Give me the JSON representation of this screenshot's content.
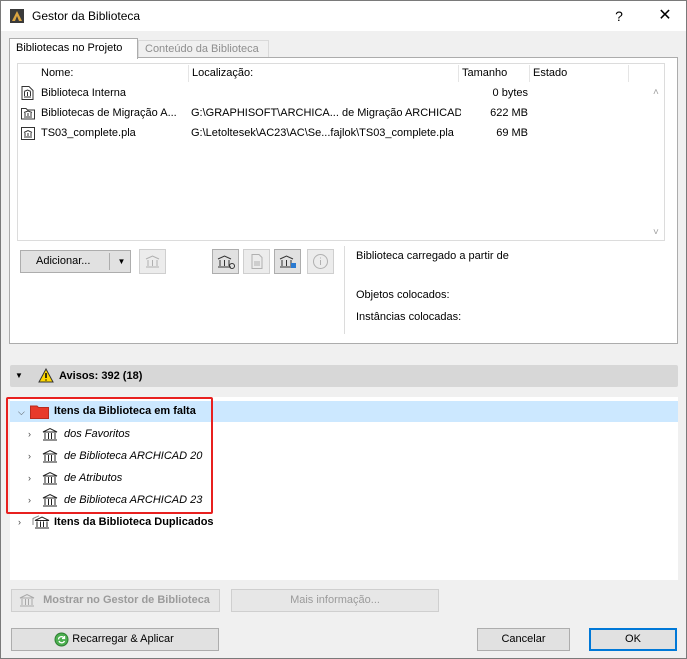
{
  "window": {
    "title": "Gestor da Biblioteca",
    "help_glyph": "?",
    "close_glyph": "✕"
  },
  "tabs": [
    {
      "label": "Bibliotecas no Projeto",
      "active": true
    },
    {
      "label": "Conteúdo da Biblioteca",
      "active": false
    }
  ],
  "table": {
    "columns": [
      "Nome:",
      "Localização:",
      "Tamanho",
      "Estado"
    ],
    "rows": [
      {
        "name": "Biblioteca Interna",
        "location": "",
        "size": "0 bytes",
        "status": ""
      },
      {
        "name": "Bibliotecas de Migração A...",
        "location": "G:\\GRAPHISOFT\\ARCHICA... de Migração ARCHICAD",
        "size": "622 MB",
        "status": ""
      },
      {
        "name": "TS03_complete.pla",
        "location": "G:\\Letoltesek\\AC23\\AC\\Se...fajlok\\TS03_complete.pla",
        "size": "69 MB",
        "status": ""
      }
    ]
  },
  "toolbar": {
    "add_label": "Adicionar...",
    "dropdown_glyph": "▼"
  },
  "info_panel": {
    "loaded_from": "Biblioteca carregado a partir de",
    "placed_objects": "Objetos colocados:",
    "placed_instances": "Instâncias colocadas:"
  },
  "warnings": {
    "label": "Avisos: 392 (18)"
  },
  "tree": {
    "missing_label": "Itens da Biblioteca em falta",
    "missing_children": [
      "dos Favoritos",
      "de Biblioteca ARCHICAD 20",
      "de Atributos",
      "de Biblioteca ARCHICAD 23"
    ],
    "duplicates_label": "Itens da Biblioteca Duplicados"
  },
  "actions": {
    "show_in_manager": "Mostrar no Gestor de Biblioteca",
    "more_info": "Mais informação...",
    "reload_apply": "Recarregar & Aplicar",
    "cancel": "Cancelar",
    "ok": "OK"
  },
  "colors": {
    "accent": "#0078d7",
    "selection": "#cce8ff",
    "highlight_box": "#e8201f",
    "folder_red": "#e8392a"
  }
}
